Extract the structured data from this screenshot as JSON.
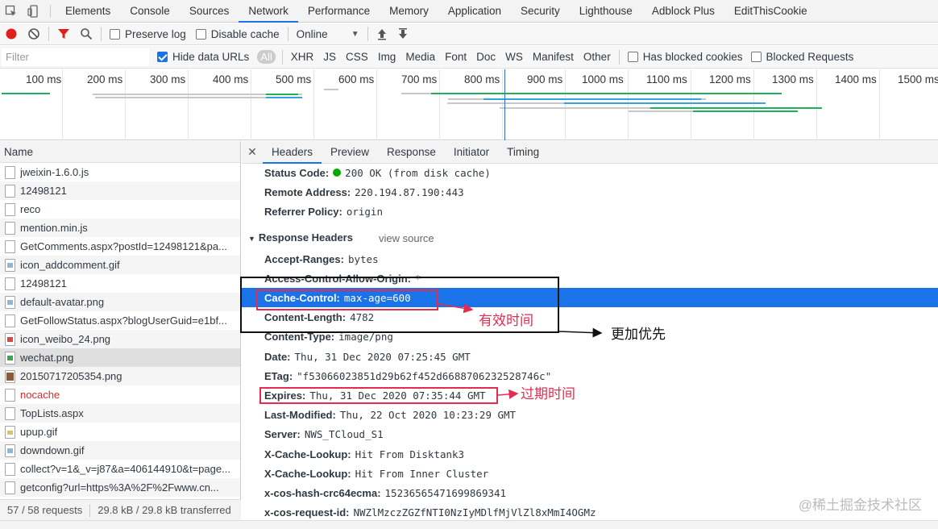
{
  "tabs": [
    "Elements",
    "Console",
    "Sources",
    "Network",
    "Performance",
    "Memory",
    "Application",
    "Security",
    "Lighthouse",
    "Adblock Plus",
    "EditThisCookie"
  ],
  "active_tab": "Network",
  "toolbar": {
    "preserve_log": "Preserve log",
    "disable_cache": "Disable cache",
    "throttle": "Online"
  },
  "filter": {
    "placeholder": "Filter",
    "hide_data_urls": "Hide data URLs",
    "all": "All",
    "types": [
      "XHR",
      "JS",
      "CSS",
      "Img",
      "Media",
      "Font",
      "Doc",
      "WS",
      "Manifest",
      "Other"
    ],
    "blocked_cookies": "Has blocked cookies",
    "blocked_requests": "Blocked Requests"
  },
  "timeline": {
    "ticks": [
      "100 ms",
      "200 ms",
      "300 ms",
      "400 ms",
      "500 ms",
      "600 ms",
      "700 ms",
      "800 ms",
      "900 ms",
      "1000 ms",
      "1100 ms",
      "1200 ms",
      "1300 ms",
      "1400 ms",
      "1500 ms"
    ],
    "colors": {
      "waiting": "#c8c8c8",
      "download": "#1fb05a",
      "connect": "#36a3e0",
      "marker": "#2d6fd6"
    }
  },
  "list": {
    "header": "Name",
    "rows": [
      {
        "name": "jweixin-1.6.0.js",
        "icon": "doc",
        "color": "#303942"
      },
      {
        "name": "12498121",
        "icon": "doc",
        "color": "#303942"
      },
      {
        "name": "reco",
        "icon": "doc",
        "color": "#303942"
      },
      {
        "name": "mention.min.js",
        "icon": "doc",
        "color": "#303942"
      },
      {
        "name": "GetComments.aspx?postId=12498121&pa...",
        "icon": "doc",
        "color": "#303942"
      },
      {
        "name": "icon_addcomment.gif",
        "icon": "img",
        "color": "#303942"
      },
      {
        "name": "12498121",
        "icon": "doc",
        "color": "#303942"
      },
      {
        "name": "default-avatar.png",
        "icon": "img",
        "color": "#303942"
      },
      {
        "name": "GetFollowStatus.aspx?blogUserGuid=e1bf...",
        "icon": "doc",
        "color": "#303942"
      },
      {
        "name": "icon_weibo_24.png",
        "icon": "red",
        "color": "#303942"
      },
      {
        "name": "wechat.png",
        "icon": "green",
        "color": "#303942"
      },
      {
        "name": "20150717205354.png",
        "icon": "photo",
        "color": "#303942"
      },
      {
        "name": "nocache",
        "icon": "doc",
        "color": "#d62b2b"
      },
      {
        "name": "TopLists.aspx",
        "icon": "doc",
        "color": "#303942"
      },
      {
        "name": "upup.gif",
        "icon": "ygif",
        "color": "#303942"
      },
      {
        "name": "downdown.gif",
        "icon": "img",
        "color": "#303942"
      },
      {
        "name": "collect?v=1&_v=j87&a=406144910&t=page...",
        "icon": "doc",
        "color": "#303942"
      },
      {
        "name": "getconfig?url=https%3A%2F%2Fwww.cn...",
        "icon": "doc",
        "color": "#303942"
      }
    ],
    "selected_index": 10,
    "summary_requests": "57 / 58 requests",
    "summary_transferred": "29.8 kB / 29.8 kB transferred"
  },
  "detail": {
    "tabs": [
      "Headers",
      "Preview",
      "Response",
      "Initiator",
      "Timing"
    ],
    "active": "Headers",
    "general": [
      {
        "key": "Status Code:",
        "value": "200 OK (from disk cache)",
        "status_dot": true
      },
      {
        "key": "Remote Address:",
        "value": "220.194.87.190:443"
      },
      {
        "key": "Referrer Policy:",
        "value": "origin"
      }
    ],
    "response_section": "Response Headers",
    "view_source": "view source",
    "response_headers": [
      {
        "key": "Accept-Ranges:",
        "value": "bytes"
      },
      {
        "key": "Access-Control-Allow-Origin:",
        "value": "*"
      },
      {
        "key": "Cache-Control:",
        "value": "max-age=600",
        "highlight": true
      },
      {
        "key": "Content-Length:",
        "value": "4782"
      },
      {
        "key": "Content-Type:",
        "value": "image/png"
      },
      {
        "key": "Date:",
        "value": "Thu, 31 Dec 2020 07:25:45 GMT"
      },
      {
        "key": "ETag:",
        "value": "\"f53066023851d29b62f452d6688706232528746c\""
      },
      {
        "key": "Expires:",
        "value": "Thu, 31 Dec 2020 07:35:44 GMT"
      },
      {
        "key": "Last-Modified:",
        "value": "Thu, 22 Oct 2020 10:23:29 GMT"
      },
      {
        "key": "Server:",
        "value": "NWS_TCloud_S1"
      },
      {
        "key": "X-Cache-Lookup:",
        "value": "Hit From Disktank3"
      },
      {
        "key": "X-Cache-Lookup:",
        "value": "Hit From Inner Cluster"
      },
      {
        "key": "x-cos-hash-crc64ecma:",
        "value": "15236565471699869341"
      },
      {
        "key": "x-cos-request-id:",
        "value": "NWZlMzczZGZfNTI0NzIyMDlfMjVlZl8xMmI4OGMz"
      }
    ]
  },
  "annotations": {
    "effective_time": "有效时间",
    "higher_priority": "更加优先",
    "expire_time": "过期时间",
    "highlight_color": "#e52b50"
  },
  "watermark": "@稀土掘金技术社区"
}
